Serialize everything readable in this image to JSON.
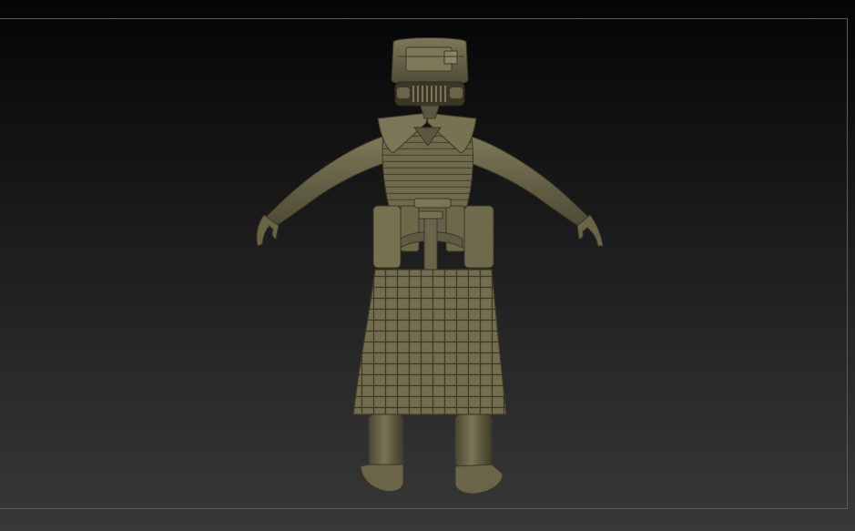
{
  "app": {
    "name": ""
  },
  "viewport": {
    "background_top": "#050505",
    "background_bottom": "#383838",
    "frame_color": "#5c5c5c"
  },
  "model": {
    "subject": "armored-soldier-sculpt",
    "pose": "A-pose",
    "material_color": "#6e6a4e",
    "material_shadow": "#3f3c2a",
    "material_highlight": "#8e8a68"
  }
}
